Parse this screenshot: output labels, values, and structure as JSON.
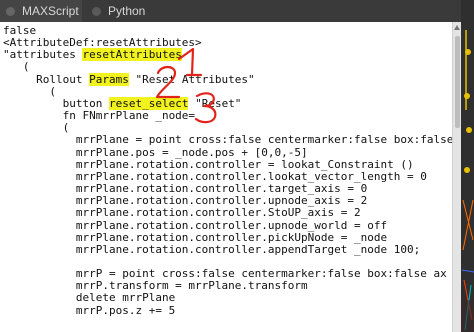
{
  "tabs": [
    {
      "label": "MAXScript",
      "active": true
    },
    {
      "label": "Python",
      "active": false
    }
  ],
  "editor": {
    "lines": [
      {
        "pre": "false",
        "hl": "",
        "post": ""
      },
      {
        "pre": "<AttributeDef:resetAttributes>",
        "hl": "",
        "post": ""
      },
      {
        "pre": "\"attributes ",
        "hl": "resetAttributes",
        "post": ""
      },
      {
        "pre": "   (",
        "hl": "",
        "post": ""
      },
      {
        "pre": "     Rollout ",
        "hl": "Params",
        "post": " \"Reset Attributes\""
      },
      {
        "pre": "       (",
        "hl": "",
        "post": ""
      },
      {
        "pre": "         button ",
        "hl": "reset_select",
        "post": " \"Reset\""
      },
      {
        "pre": "         fn FNmrrPlane _node=",
        "hl": "",
        "post": ""
      },
      {
        "pre": "         (",
        "hl": "",
        "post": ""
      },
      {
        "pre": "           mrrPlane = point cross:false centermarker:false box:false",
        "hl": "",
        "post": ""
      },
      {
        "pre": "           mrrPlane.pos = _node.pos + [0,0,-5]",
        "hl": "",
        "post": ""
      },
      {
        "pre": "           mrrPlane.rotation.controller = lookat_Constraint ()",
        "hl": "",
        "post": ""
      },
      {
        "pre": "           mrrPlane.rotation.controller.lookat_vector_length = 0",
        "hl": "",
        "post": ""
      },
      {
        "pre": "           mrrPlane.rotation.controller.target_axis = 0",
        "hl": "",
        "post": ""
      },
      {
        "pre": "           mrrPlane.rotation.controller.upnode_axis = 2",
        "hl": "",
        "post": ""
      },
      {
        "pre": "           mrrPlane.rotation.controller.StoUP_axis = 2",
        "hl": "",
        "post": ""
      },
      {
        "pre": "           mrrPlane.rotation.controller.upnode_world = off",
        "hl": "",
        "post": ""
      },
      {
        "pre": "           mrrPlane.rotation.controller.pickUpNode = _node",
        "hl": "",
        "post": ""
      },
      {
        "pre": "           mrrPlane.rotation.controller.appendTarget _node 100;",
        "hl": "",
        "post": ""
      },
      {
        "pre": "",
        "hl": "",
        "post": ""
      },
      {
        "pre": "           mrrP = point cross:false centermarker:false box:false ax",
        "hl": "",
        "post": ""
      },
      {
        "pre": "           mrrP.transform = mrrPlane.transform",
        "hl": "",
        "post": ""
      },
      {
        "pre": "           delete mrrPlane",
        "hl": "",
        "post": ""
      },
      {
        "pre": "           mrrP.pos.z += 5",
        "hl": "",
        "post": ""
      }
    ]
  },
  "annotations": [
    "1",
    "2",
    "3"
  ],
  "colors": {
    "highlight": "#f2f21e",
    "annotation": "#e0241b"
  }
}
